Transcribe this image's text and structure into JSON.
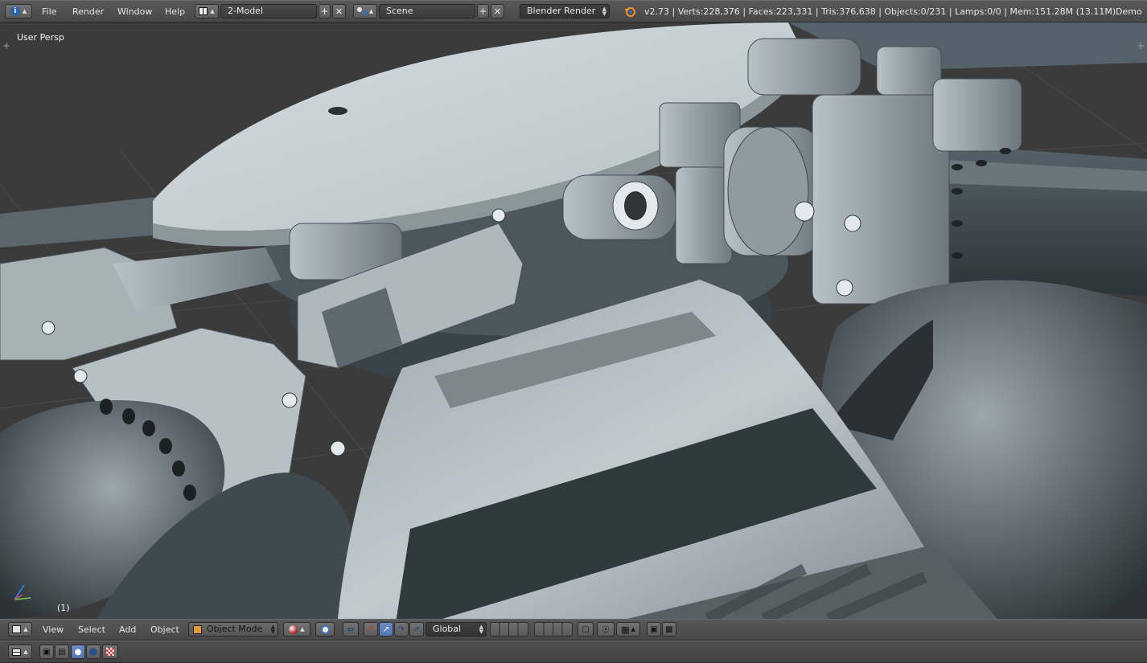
{
  "topbar": {
    "menus": [
      "File",
      "Render",
      "Window",
      "Help"
    ],
    "screen_layout": "2-Model",
    "scene": "Scene",
    "render_engine": "Blender Render",
    "stats": "v2.73 | Verts:228,376 | Faces:223,331 | Tris:376,638 | Objects:0/231 | Lamps:0/0 | Mem:151.28M (13.11M)",
    "scene_name_right": "Demo"
  },
  "viewport": {
    "view_label": "User Persp",
    "frame_label": "(1)"
  },
  "view_header": {
    "menus": [
      "View",
      "Select",
      "Add",
      "Object"
    ],
    "mode": "Object Mode",
    "orientation": "Global"
  },
  "colors": {
    "header_bg": "#4d4d4d",
    "viewport_bg": "#3d3d3d",
    "model_light": "#c9d3d8",
    "model_dark": "#3e4a50",
    "active_blue": "#5680c2"
  }
}
